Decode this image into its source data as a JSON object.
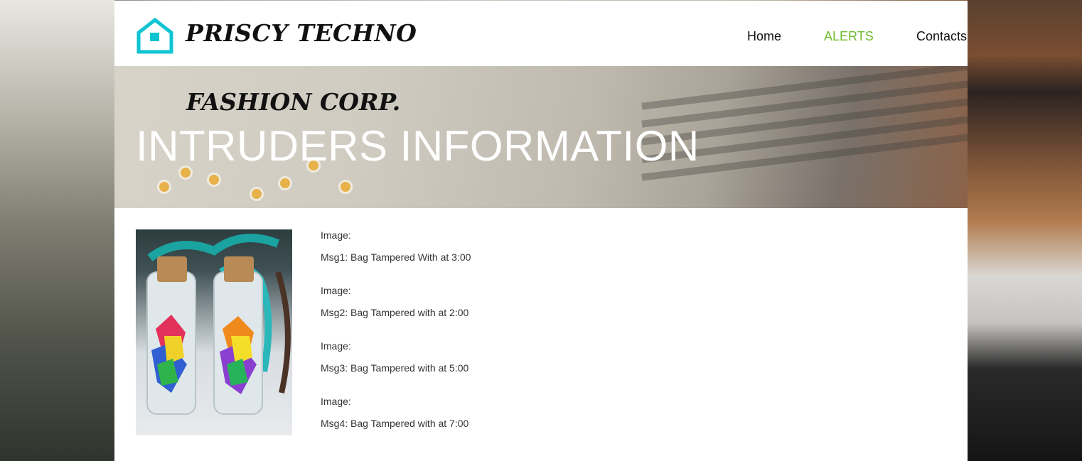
{
  "header": {
    "brand": "PRISCY TECHNO",
    "logo_icon": "home-icon",
    "accent_color": "#0fc4d2",
    "nav": [
      {
        "label": "Home",
        "active": false
      },
      {
        "label": "ALERTS",
        "active": true
      },
      {
        "label": "Contacts",
        "active": false
      }
    ],
    "active_color": "#6dbb2e"
  },
  "hero": {
    "subtitle": "FASHION CORP.",
    "title": "INTRUDERS INFORMATION"
  },
  "alerts": [
    {
      "image_label": "Image:",
      "message": "Msg1: Bag Tampered With at 3:00"
    },
    {
      "image_label": "Image:",
      "message": "Msg2: Bag Tampered with at 2:00"
    },
    {
      "image_label": "Image:",
      "message": "Msg3: Bag Tampered with at 5:00"
    },
    {
      "image_label": "Image:",
      "message": "Msg4: Bag Tampered with at 7:00"
    }
  ]
}
